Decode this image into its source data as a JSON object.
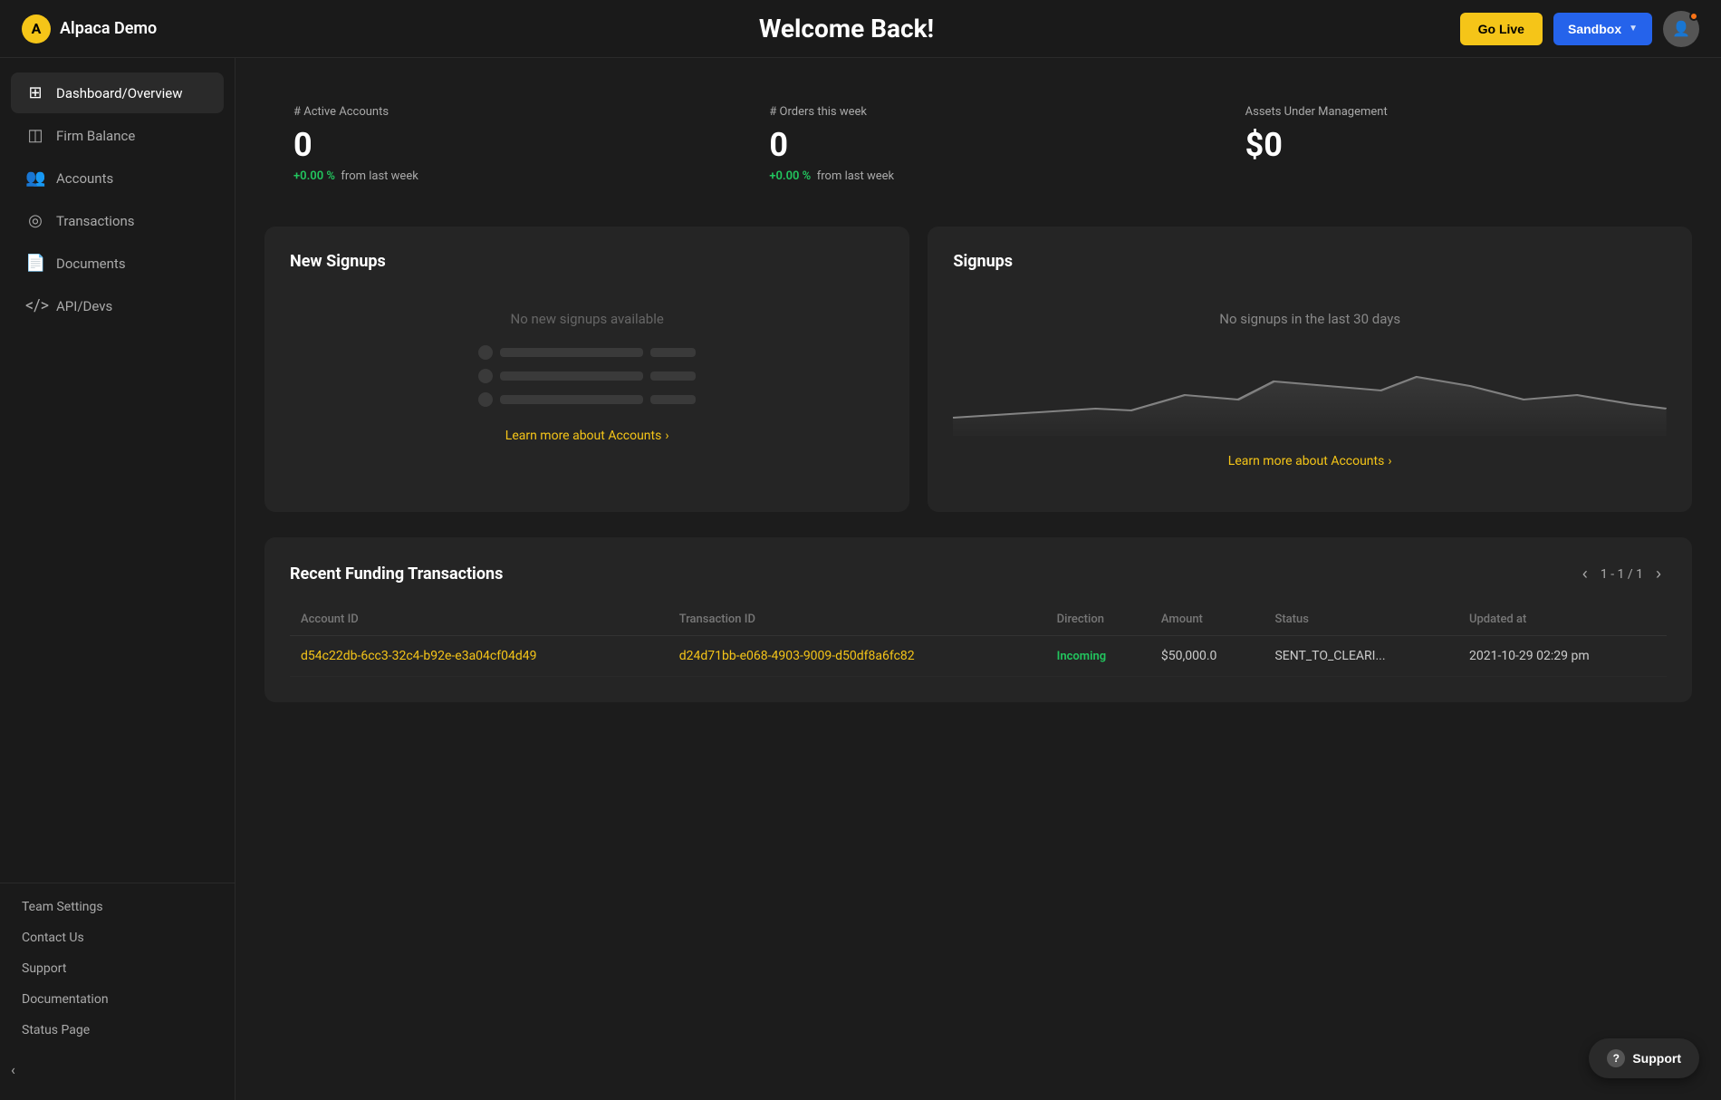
{
  "app": {
    "logo_initial": "A",
    "logo_name": "Alpaca Demo"
  },
  "header": {
    "title": "Welcome Back!",
    "go_live_label": "Go Live",
    "sandbox_label": "Sandbox"
  },
  "stats": [
    {
      "label": "# Active Accounts",
      "value": "0",
      "change_value": "+0.00 %",
      "change_text": "from last week"
    },
    {
      "label": "# Orders this week",
      "value": "0",
      "change_value": "+0.00 %",
      "change_text": "from last week"
    },
    {
      "label": "Assets Under Management",
      "value": "$0",
      "change_value": null,
      "change_text": null
    }
  ],
  "sidebar": {
    "items": [
      {
        "label": "Dashboard/Overview",
        "icon": "⊞",
        "active": true
      },
      {
        "label": "Firm Balance",
        "icon": "◫",
        "active": false
      },
      {
        "label": "Accounts",
        "icon": "👥",
        "active": false
      },
      {
        "label": "Transactions",
        "icon": "◎",
        "active": false
      },
      {
        "label": "Documents",
        "icon": "📄",
        "active": false
      },
      {
        "label": "API/Devs",
        "icon": "</>",
        "active": false
      }
    ],
    "bottom_items": [
      {
        "label": "Team Settings"
      },
      {
        "label": "Contact Us"
      },
      {
        "label": "Support"
      },
      {
        "label": "Documentation"
      },
      {
        "label": "Status Page"
      }
    ]
  },
  "new_signups": {
    "title": "New Signups",
    "empty_text": "No new signups available",
    "link_text": "Learn more about Accounts",
    "link_arrow": "›"
  },
  "signups_chart": {
    "title": "Signups",
    "empty_text": "No signups in the last 30 days",
    "link_text": "Learn more about Accounts",
    "link_arrow": "›"
  },
  "transactions": {
    "title": "Recent Funding Transactions",
    "pagination": "1 - 1 / 1",
    "columns": [
      "Account ID",
      "Transaction ID",
      "Direction",
      "Amount",
      "Status",
      "Updated at"
    ],
    "rows": [
      {
        "account_id": "d54c22db-6cc3-32c4-b92e-e3a04cf04d49",
        "transaction_id": "d24d71bb-e068-4903-9009-d50df8a6fc82",
        "direction": "Incoming",
        "amount": "$50,000.0",
        "status": "SENT_TO_CLEARI...",
        "updated_at": "2021-10-29 02:29 pm"
      }
    ]
  },
  "support": {
    "label": "Support"
  }
}
